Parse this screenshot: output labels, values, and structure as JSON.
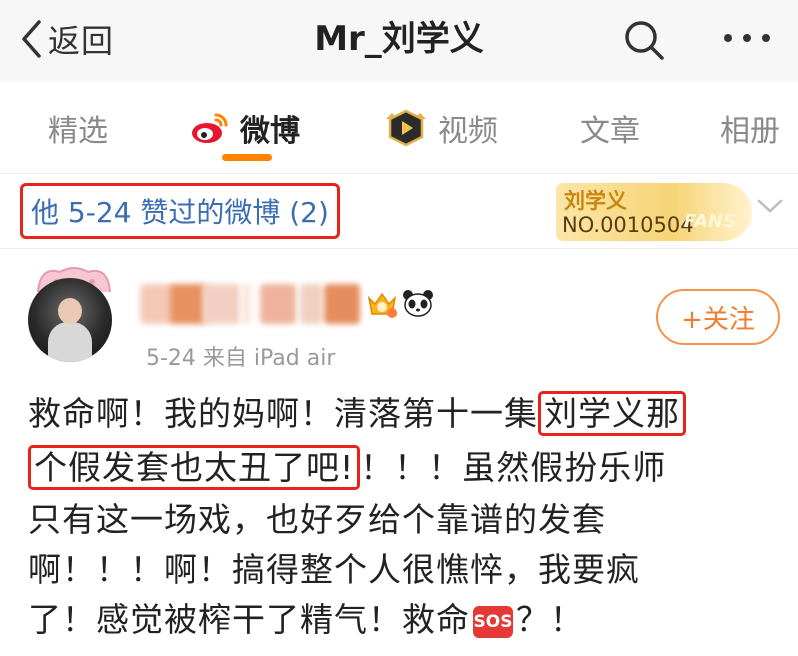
{
  "navbar": {
    "back_label": "返回",
    "title": "Mr_刘学义",
    "icons": {
      "back": "chevron-left-icon",
      "search": "search-icon",
      "more": "more-icon"
    }
  },
  "tabs": [
    {
      "label": "精选",
      "active": false
    },
    {
      "label": "微博",
      "active": true,
      "icon": "weibo-icon"
    },
    {
      "label": "视频",
      "active": false,
      "icon": "video-play-icon"
    },
    {
      "label": "文章",
      "active": false
    },
    {
      "label": "相册",
      "active": false
    }
  ],
  "filter": {
    "label": "他 5-24 赞过的微博 (2)",
    "fans_badge": {
      "name": "刘学义",
      "number": "NO.0010504",
      "word": "FANS"
    }
  },
  "post": {
    "meta": "5-24  来自 iPad air",
    "follow_label": "+关注",
    "badges": [
      "vip-crown-icon",
      "panda-icon"
    ],
    "lines": [
      {
        "before": "救命啊！我的妈啊！清落第十一集",
        "highlight": "刘学义那"
      },
      {
        "highlight": "个假发套也太丑了吧!",
        "after": "！！！虽然假扮乐师"
      },
      {
        "text": "只有这一场戏，也好歹给个靠谱的发套"
      },
      {
        "text": "啊！！！啊！搞得整个人很憔悴，我要疯"
      },
      {
        "before": "了！感觉被榨干了精气！救命",
        "emoji": "SOS",
        "after": "？！"
      }
    ]
  },
  "colors": {
    "accent_orange": "#ff8200",
    "link_blue": "#3a6db3",
    "highlight_red": "#e8231b",
    "navbar_bg": "#f7f7f7"
  }
}
